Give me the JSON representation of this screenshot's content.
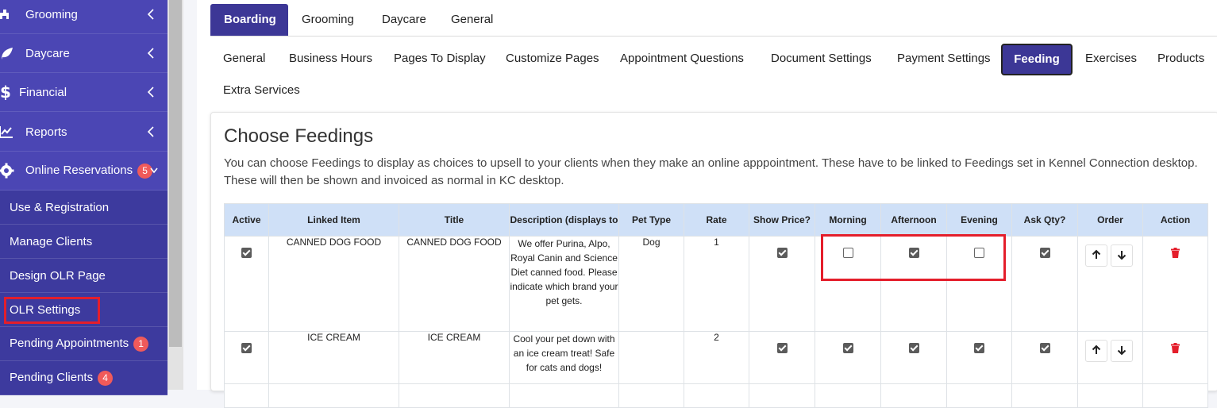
{
  "sidebar": {
    "items": [
      {
        "label": "Grooming",
        "icon": "dog-icon"
      },
      {
        "label": "Daycare",
        "icon": "leaf-icon"
      },
      {
        "label": "Financial",
        "icon": "dollar-icon"
      },
      {
        "label": "Reports",
        "icon": "chart-icon"
      },
      {
        "label": "Online Reservations",
        "icon": "gear-icon",
        "badge": "5"
      }
    ],
    "subitems": [
      {
        "label": "Use & Registration"
      },
      {
        "label": "Manage Clients"
      },
      {
        "label": "Design OLR Page"
      },
      {
        "label": "OLR Settings"
      },
      {
        "label": "Pending Appointments",
        "badge": "1"
      },
      {
        "label": "Pending Clients",
        "badge": "4"
      }
    ]
  },
  "top_tabs": [
    "Boarding",
    "Grooming",
    "Daycare",
    "General"
  ],
  "sub_tabs": [
    "General",
    "Business Hours",
    "Pages To Display",
    "Customize Pages",
    "Appointment Questions",
    "Document Settings",
    "Payment Settings",
    "Feeding",
    "Exercises",
    "Products",
    "Extra Services"
  ],
  "card": {
    "title": "Choose Feedings",
    "description": "You can choose Feedings to display as choices to upsell to your clients when they make an online apppointment. These have to be linked to Feedings set in Kennel Connection desktop. These will then be shown and invoiced as normal in KC desktop."
  },
  "table": {
    "columns": [
      "Active",
      "Linked Item",
      "Title",
      "Description (displays to",
      "Pet Type",
      "Rate",
      "Show Price?",
      "Morning",
      "Afternoon",
      "Evening",
      "Ask Qty?",
      "Order",
      "Action"
    ],
    "rows": [
      {
        "active": true,
        "linked_item": "CANNED DOG FOOD",
        "title": "CANNED DOG FOOD",
        "description": "We offer Purina, Alpo, Royal Canin and Science Diet canned food.  Please indicate which brand your pet gets.",
        "pet_type": "Dog",
        "rate": "1",
        "show_price": true,
        "morning": false,
        "afternoon": true,
        "evening": false,
        "ask_qty": true
      },
      {
        "active": true,
        "linked_item": "ICE CREAM",
        "title": "ICE CREAM",
        "description": "Cool your pet down with an ice cream treat! Safe for cats and dogs!",
        "pet_type": "",
        "rate": "2",
        "show_price": true,
        "morning": true,
        "afternoon": true,
        "evening": true,
        "ask_qty": true
      }
    ]
  },
  "colors": {
    "sidebar_bg": "#4b46b4",
    "accent": "#3c3796",
    "highlight": "#e41e2b",
    "header_bg": "#cfe0f7",
    "delete": "#e41e2b"
  }
}
